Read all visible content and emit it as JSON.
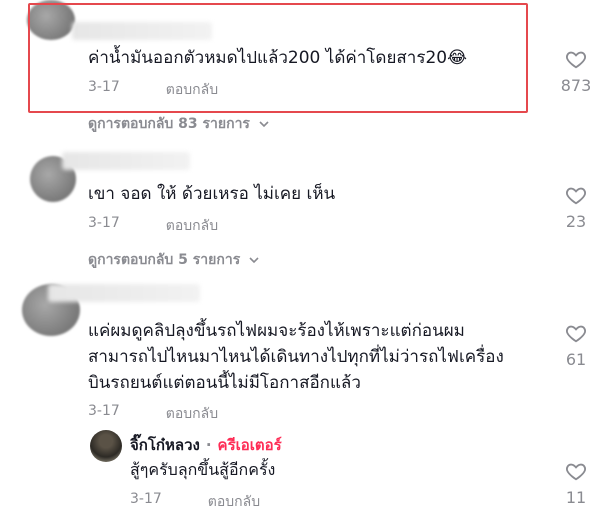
{
  "comments": [
    {
      "text": "ค่าน้ำมันออกตัวหมดไปแล้ว200 ได้ค่าโดยสาร20😂",
      "date": "3-17",
      "reply_label": "ตอบกลับ",
      "likes": "873",
      "view_replies": "ดูการตอบกลับ 83 รายการ"
    },
    {
      "text": "เขา จอด ให้ ด้วยเหรอ ไม่เคย เห็น",
      "date": "3-17",
      "reply_label": "ตอบกลับ",
      "likes": "23",
      "view_replies": "ดูการตอบกลับ 5 รายการ"
    },
    {
      "text_lines": [
        "แค่ผมดูคลิปลุงขึ้นรถไฟผมจะร้องไห้เพราะแต่ก่อนผม",
        "สามารถไปไหนมาไหนได้เดินทางไปทุกที่ไม่ว่ารถไฟเครื่อง",
        "บินรถยนต์แต่ตอนนี้ไม่มีโอกาสอีกแล้ว"
      ],
      "date": "3-17",
      "reply_label": "ตอบกลับ",
      "likes": "61"
    }
  ],
  "reply": {
    "author": "จิ๊กโก๋หลวง",
    "separator": "·",
    "badge": "ครีเอเตอร์",
    "text": "สู้ๆครับลุกขึ้นสู้อีกครั้ง",
    "date": "3-17",
    "reply_label": "ตอบกลับ",
    "likes": "11"
  },
  "colors": {
    "highlight_border": "#e5484d",
    "creator_badge": "#fe2c55",
    "muted_text": "#8a8b91"
  },
  "icons": [
    "heart-icon",
    "chevron-down-icon"
  ]
}
